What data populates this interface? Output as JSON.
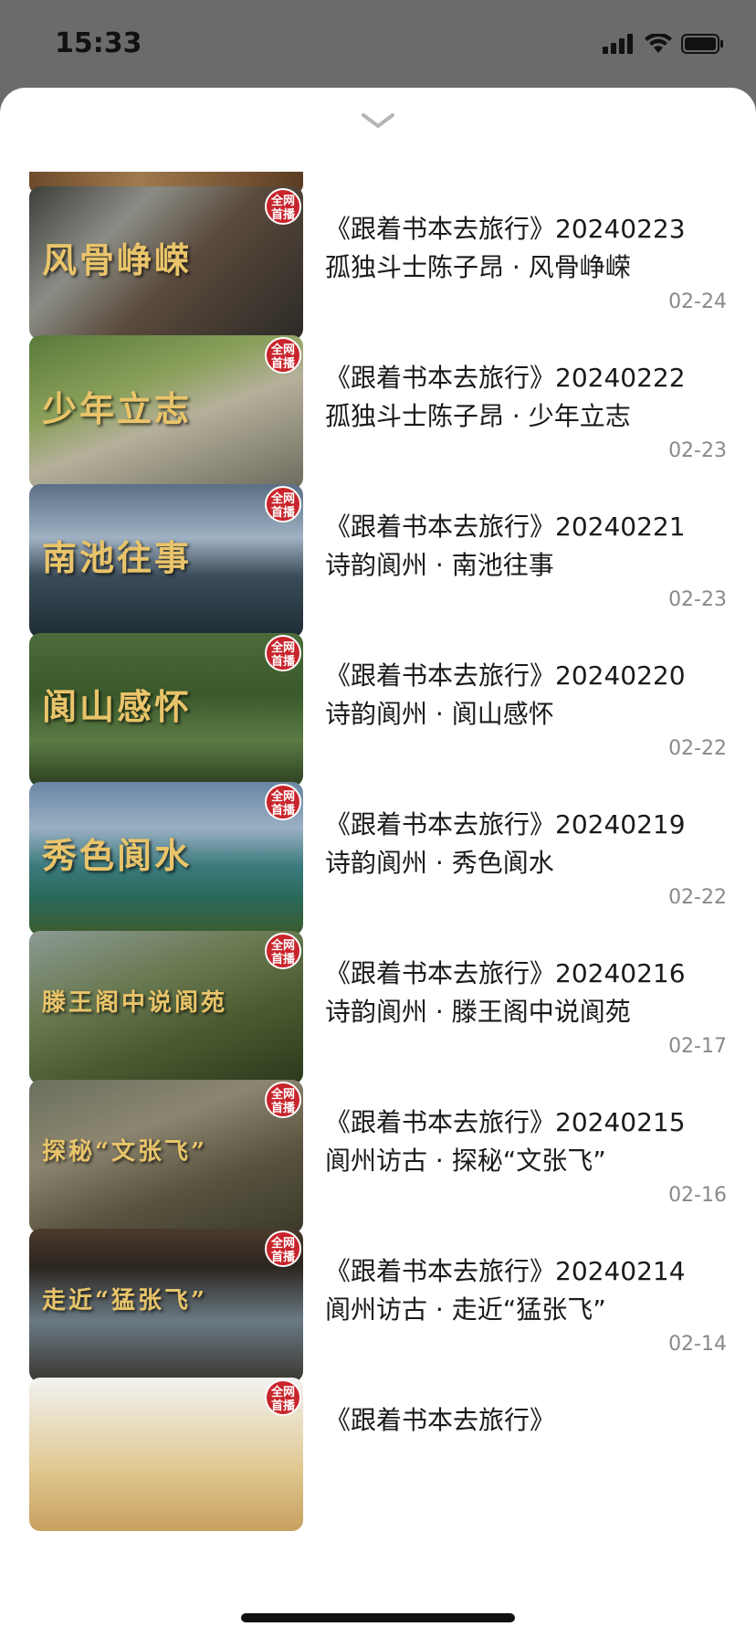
{
  "status": {
    "time": "15:33"
  },
  "colors": {
    "badge": "#c8242b",
    "date": "#8a8a8a",
    "overlay": "#e9c46a"
  },
  "icons": {
    "collapse": "chevron-down-icon",
    "signal": "signal-icon",
    "wifi": "wifi-icon",
    "battery": "battery-icon"
  },
  "badge_label_line1": "全网",
  "badge_label_line2": "首播",
  "items": [
    {
      "title": "《跟着书本去旅行》20240223",
      "subtitle": "孤独斗士陈子昂 · 风骨峥嵘",
      "date": "02-24",
      "overlay": "风骨峥嵘"
    },
    {
      "title": "《跟着书本去旅行》20240222",
      "subtitle": "孤独斗士陈子昂 · 少年立志",
      "date": "02-23",
      "overlay": "少年立志"
    },
    {
      "title": "《跟着书本去旅行》20240221",
      "subtitle": "诗韵阆州 · 南池往事",
      "date": "02-23",
      "overlay": "南池往事"
    },
    {
      "title": "《跟着书本去旅行》20240220",
      "subtitle": "诗韵阆州 · 阆山感怀",
      "date": "02-22",
      "overlay": "阆山感怀"
    },
    {
      "title": "《跟着书本去旅行》20240219",
      "subtitle": "诗韵阆州 · 秀色阆水",
      "date": "02-22",
      "overlay": "秀色阆水"
    },
    {
      "title": "《跟着书本去旅行》20240216",
      "subtitle": "诗韵阆州 · 滕王阁中说阆苑",
      "date": "02-17",
      "overlay": "滕王阁中说阆苑"
    },
    {
      "title": "《跟着书本去旅行》20240215",
      "subtitle": "阆州访古 · 探秘“文张飞”",
      "date": "02-16",
      "overlay": "探秘“文张飞”"
    },
    {
      "title": "《跟着书本去旅行》20240214",
      "subtitle": "阆州访古 · 走近“猛张飞”",
      "date": "02-14",
      "overlay": "走近“猛张飞”"
    },
    {
      "title": "《跟着书本去旅行》",
      "subtitle": "",
      "date": "",
      "overlay": ""
    }
  ]
}
